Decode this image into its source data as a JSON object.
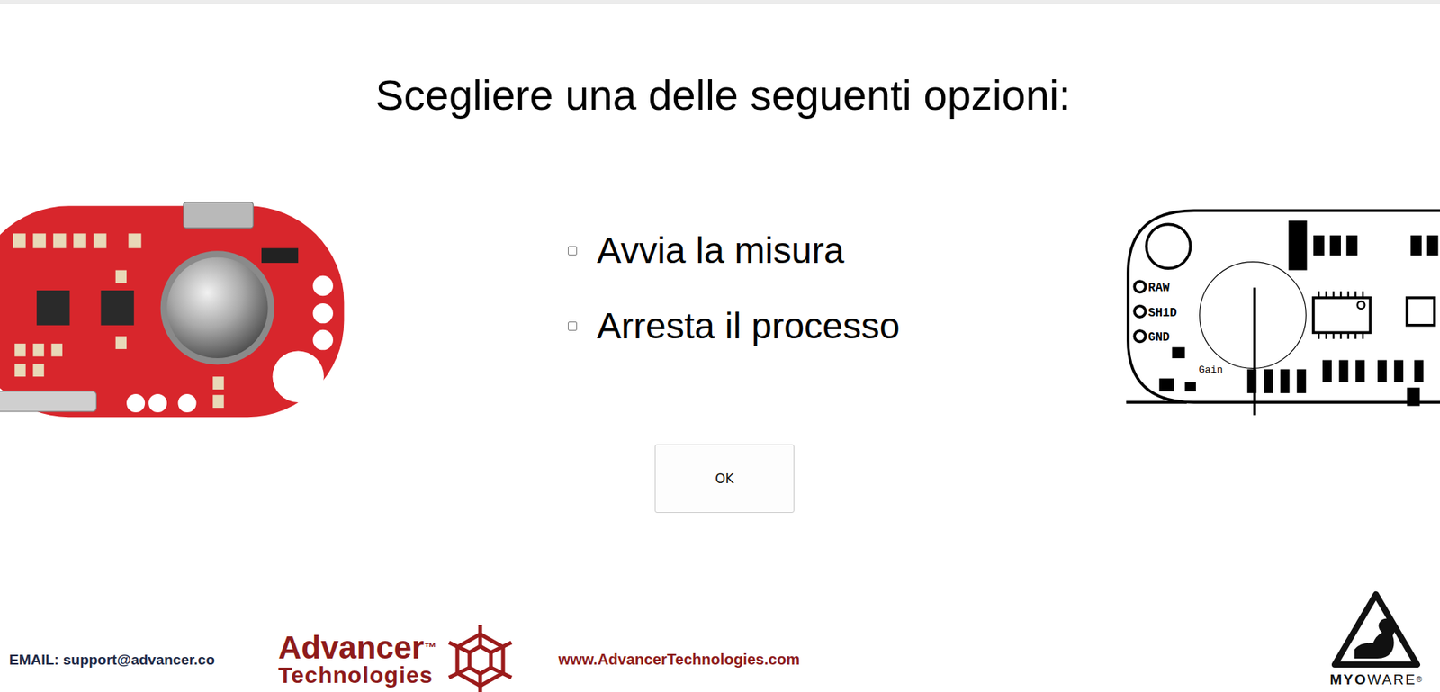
{
  "title": "Scegliere una delle seguenti opzioni:",
  "options": [
    {
      "label": "Avvia la misura",
      "checked": false
    },
    {
      "label": "Arresta il processo",
      "checked": false
    }
  ],
  "buttons": [
    "OK"
  ],
  "diagram": {
    "labels": [
      "RAW",
      "SH1D",
      "GND"
    ],
    "gain": "Gain"
  },
  "footer": {
    "email": "EMAIL: support@advancer.co",
    "brand": {
      "name": "Advancer",
      "trademark": "™",
      "subtitle": "Technologies"
    },
    "website": "www.AdvancerTechnologies.com",
    "myoware": {
      "bold": "MYO",
      "regular": "WARE",
      "registered": "®"
    }
  }
}
